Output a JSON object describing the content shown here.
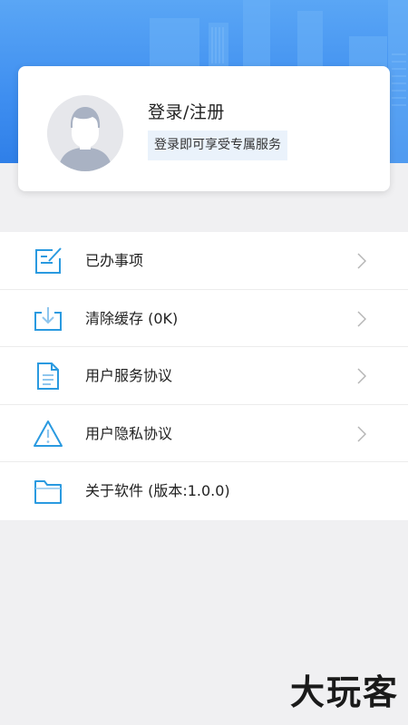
{
  "colors": {
    "header_blue": "#3e8ef0",
    "icon_blue": "#2a9ae0",
    "text_dark": "#222222",
    "chevron": "#b5b5b5"
  },
  "profile": {
    "title": "登录/注册",
    "subtitle": "登录即可享受专属服务",
    "avatar_icon": "default-user-avatar"
  },
  "menu": {
    "items": [
      {
        "icon": "edit-note-icon",
        "label": "已办事项"
      },
      {
        "icon": "download-tray-icon",
        "label": "清除缓存 (0K)"
      },
      {
        "icon": "document-icon",
        "label": "用户服务协议"
      },
      {
        "icon": "warning-icon",
        "label": "用户隐私协议"
      },
      {
        "icon": "folder-icon",
        "label": "关于软件 (版本:1.0.0)"
      }
    ]
  },
  "watermark": "大玩客"
}
